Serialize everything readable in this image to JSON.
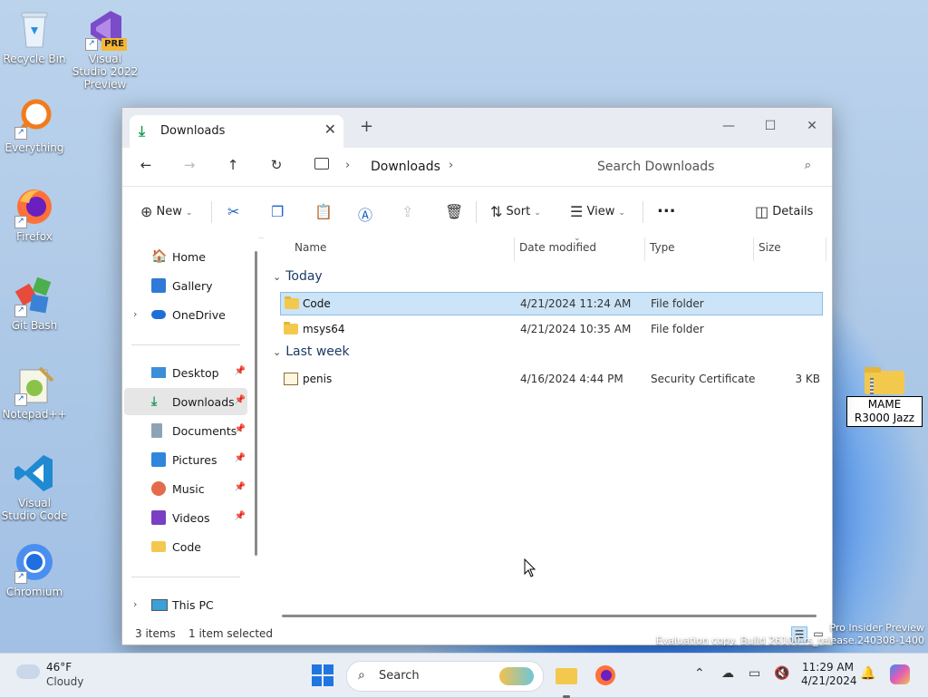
{
  "desktop": {
    "icons": [
      {
        "label": "Recycle Bin"
      },
      {
        "label": "Visual Studio 2022 Preview",
        "badge": "PRE"
      },
      {
        "label": "Everything"
      },
      {
        "label": "Firefox"
      },
      {
        "label": "Git Bash"
      },
      {
        "label": "Notepad++"
      },
      {
        "label": "Visual Studio Code"
      },
      {
        "label": "Chromium"
      }
    ],
    "renaming_item": {
      "value": "MAME R3000 Jazz"
    }
  },
  "window": {
    "tab_title": "Downloads",
    "address": {
      "segment": "Downloads"
    },
    "search_placeholder": "Search Downloads",
    "toolbar": {
      "new_label": "New",
      "sort_label": "Sort",
      "view_label": "View",
      "more_label": "...",
      "details_label": "Details"
    },
    "nav": {
      "items": [
        {
          "label": "Home"
        },
        {
          "label": "Gallery"
        },
        {
          "label": "OneDrive"
        },
        {
          "label": "Desktop"
        },
        {
          "label": "Downloads"
        },
        {
          "label": "Documents"
        },
        {
          "label": "Pictures"
        },
        {
          "label": "Music"
        },
        {
          "label": "Videos"
        },
        {
          "label": "Code"
        },
        {
          "label": "This PC"
        }
      ]
    },
    "columns": {
      "name": "Name",
      "date": "Date modified",
      "type": "Type",
      "size": "Size"
    },
    "groups": [
      {
        "label": "Today",
        "rows": [
          {
            "name": "Code",
            "date": "4/21/2024 11:24 AM",
            "type": "File folder",
            "size": ""
          },
          {
            "name": "msys64",
            "date": "4/21/2024 10:35 AM",
            "type": "File folder",
            "size": ""
          }
        ]
      },
      {
        "label": "Last week",
        "rows": [
          {
            "name": "penis",
            "date": "4/16/2024 4:44 PM",
            "type": "Security Certificate",
            "size": "3 KB"
          }
        ]
      }
    ],
    "status": {
      "count": "3 items",
      "selection": "1 item selected"
    }
  },
  "watermark": {
    "line1": "Pro Insider Preview",
    "line2": "Evaluation copy. Build 26100.rs_release.240308-1400"
  },
  "taskbar": {
    "weather": {
      "temp": "46°F",
      "condition": "Cloudy"
    },
    "search_label": "Search",
    "clock": {
      "time": "11:29 AM",
      "date": "4/21/2024"
    }
  }
}
